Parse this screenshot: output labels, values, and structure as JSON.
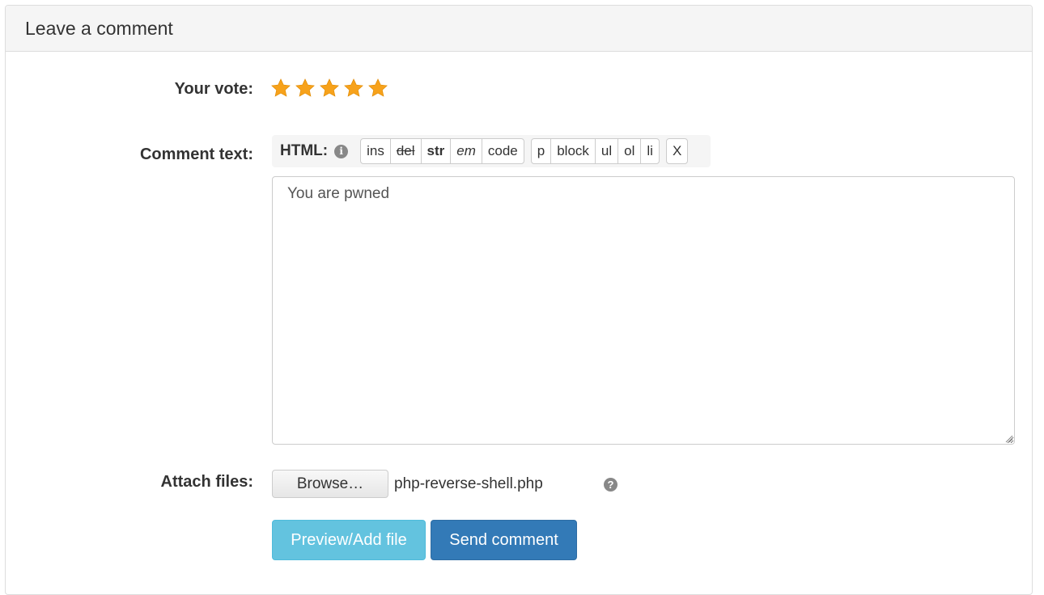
{
  "panel": {
    "title": "Leave a comment"
  },
  "vote": {
    "label": "Your vote:",
    "rating": 5,
    "max": 5,
    "star_color": "#f5a623"
  },
  "comment": {
    "label": "Comment text:",
    "html_label": "HTML:",
    "info_icon": "info-circle-icon",
    "group1": [
      "ins",
      "del",
      "str",
      "em",
      "code"
    ],
    "group2": [
      "p",
      "block",
      "ul",
      "ol",
      "li"
    ],
    "close_label": "X",
    "value": "You are pwned"
  },
  "attach": {
    "label": "Attach files:",
    "browse_label": "Browse…",
    "file_name": "php-reverse-shell.php",
    "help_icon": "question-circle-icon"
  },
  "actions": {
    "preview_label": "Preview/Add file",
    "send_label": "Send comment",
    "preview_color": "#5bc0de",
    "send_color": "#337ab7"
  }
}
